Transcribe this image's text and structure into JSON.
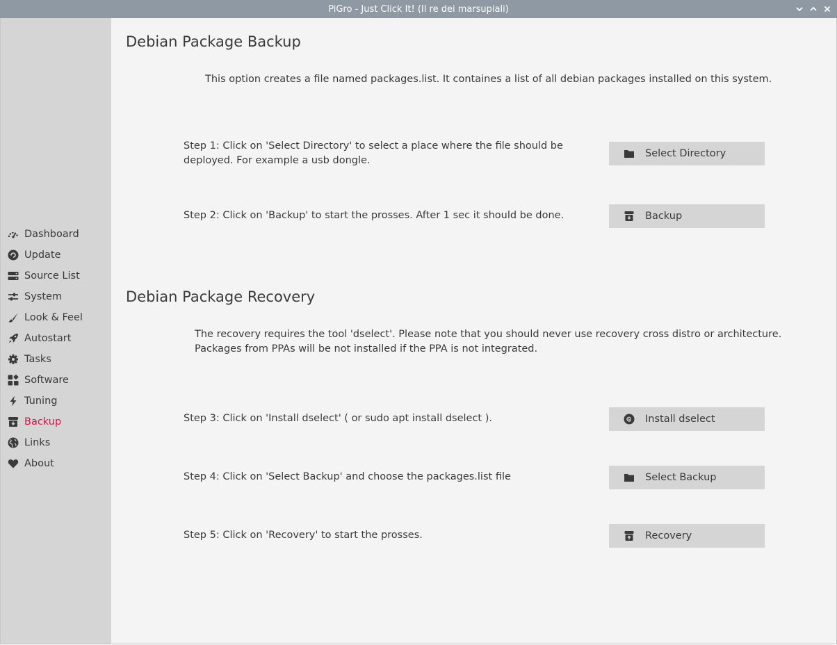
{
  "window": {
    "title": "PiGro - Just Click It! (Il re dei marsupiali)",
    "controls": [
      "minimize",
      "maximize",
      "close"
    ]
  },
  "sidebar": {
    "active_color": "#d0154b",
    "items": [
      {
        "label": "Dashboard",
        "icon": "dashboard-icon"
      },
      {
        "label": "Update",
        "icon": "update-icon"
      },
      {
        "label": "Source List",
        "icon": "server-icon"
      },
      {
        "label": "System",
        "icon": "sliders-icon"
      },
      {
        "label": "Look & Feel",
        "icon": "brush-icon"
      },
      {
        "label": "Autostart",
        "icon": "rocket-icon"
      },
      {
        "label": "Tasks",
        "icon": "gear-icon"
      },
      {
        "label": "Software",
        "icon": "apps-icon"
      },
      {
        "label": "Tuning",
        "icon": "bolt-icon"
      },
      {
        "label": "Backup",
        "icon": "archive-icon",
        "active": true
      },
      {
        "label": "Links",
        "icon": "globe-icon"
      },
      {
        "label": "About",
        "icon": "heart-icon"
      }
    ]
  },
  "backup": {
    "heading": "Debian Package Backup",
    "description": "This option creates a file named packages.list. It containes a list of all debian packages installed on this system.",
    "step1": "Step 1: Click on 'Select Directory' to select a place where the file should be deployed. For example a usb dongle.",
    "step1_button": "Select Directory",
    "step2": "Step 2: Click on 'Backup' to start the prosses. After 1 sec it should be done.",
    "step2_button": "Backup"
  },
  "recovery": {
    "heading": "Debian Package Recovery",
    "description_line1": "The recovery requires the tool 'dselect'. Please note that you should never use recovery cross distro or architecture.",
    "description_line2": "Packages from PPAs will be not installed if the PPA is not integrated.",
    "step3": "Step 3: Click on 'Install dselect' ( or sudo apt install dselect ).",
    "step3_button": "Install dselect",
    "step4": "Step 4: Click on 'Select Backup' and choose the packages.list file",
    "step4_button": "Select Backup",
    "step5": "Step 5: Click on 'Recovery' to start the prosses.",
    "step5_button": "Recovery"
  }
}
